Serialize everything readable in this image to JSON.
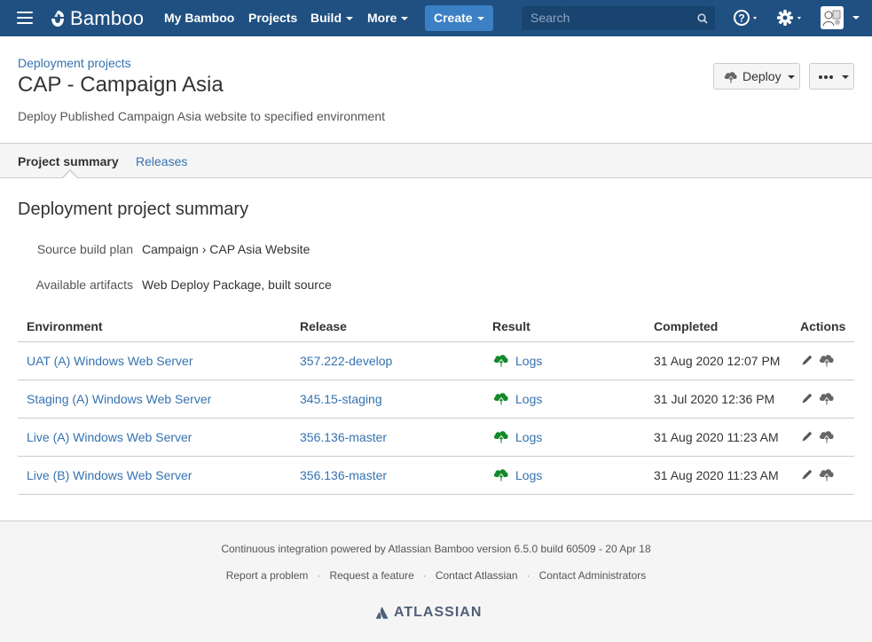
{
  "nav": {
    "brand": "Bamboo",
    "items": [
      "My Bamboo",
      "Projects",
      "Build",
      "More"
    ],
    "create_label": "Create",
    "search_placeholder": "Search"
  },
  "header": {
    "breadcrumb": "Deployment projects",
    "title": "CAP - Campaign Asia",
    "description": "Deploy Published Campaign Asia website to specified environment",
    "deploy_label": "Deploy"
  },
  "tabs": [
    "Project summary",
    "Releases"
  ],
  "summary": {
    "title": "Deployment project summary",
    "source_label": "Source build plan",
    "source_value": "Campaign › CAP Asia Website",
    "artifacts_label": "Available artifacts",
    "artifacts_value": "Web Deploy Package, built source"
  },
  "table": {
    "headers": [
      "Environment",
      "Release",
      "Result",
      "Completed",
      "Actions"
    ],
    "rows": [
      {
        "environment": "UAT (A) Windows Web Server",
        "release": "357.222-develop",
        "result": "Logs",
        "completed": "31 Aug 2020 12:07 PM"
      },
      {
        "environment": "Staging (A) Windows Web Server",
        "release": "345.15-staging",
        "result": "Logs",
        "completed": "31 Jul 2020 12:36 PM"
      },
      {
        "environment": "Live (A) Windows Web Server",
        "release": "356.136-master",
        "result": "Logs",
        "completed": "31 Aug 2020 11:23 AM"
      },
      {
        "environment": "Live (B) Windows Web Server",
        "release": "356.136-master",
        "result": "Logs",
        "completed": "31 Aug 2020 11:23 AM"
      }
    ]
  },
  "footer": {
    "powered": "Continuous integration powered by Atlassian Bamboo version 6.5.0 build 60509 - 20 Apr 18",
    "links": [
      "Report a problem",
      "Request a feature",
      "Contact Atlassian",
      "Contact Administrators"
    ],
    "logo_text": "ATLASSIAN"
  },
  "colors": {
    "nav_bg": "#205081",
    "link": "#3572b0",
    "success": "#14892c",
    "create_btn": "#3b7fc4"
  }
}
